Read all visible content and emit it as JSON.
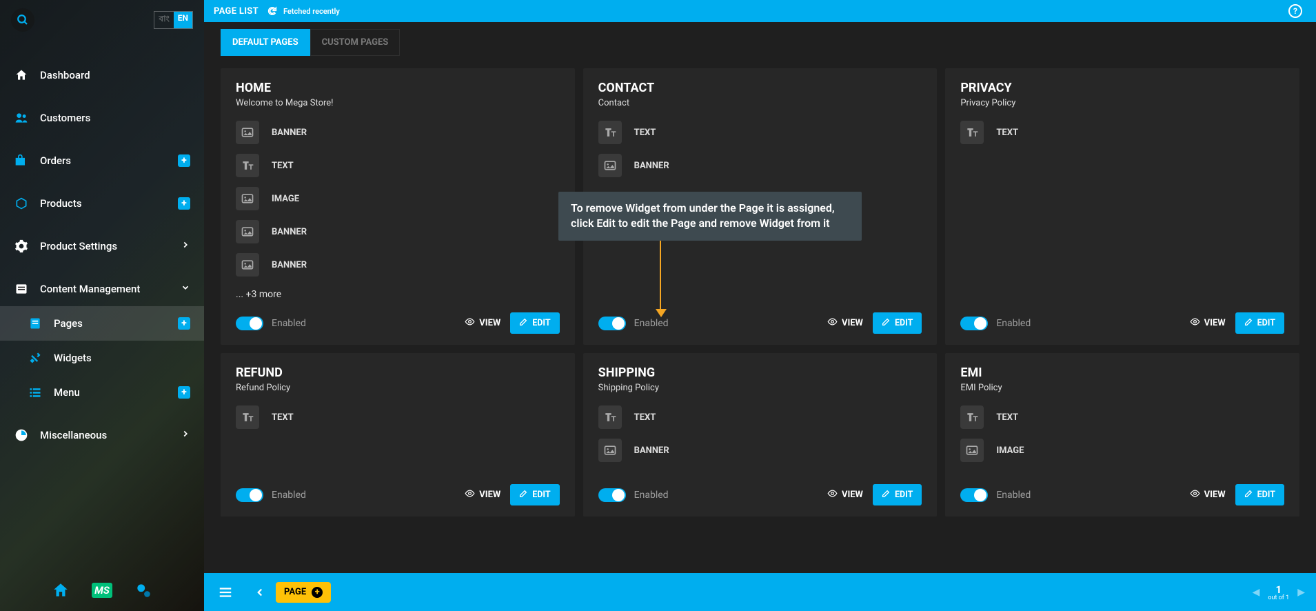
{
  "lang": {
    "inactive": "বাং",
    "active": "EN"
  },
  "sidebar": {
    "items": [
      {
        "label": "Dashboard"
      },
      {
        "label": "Customers"
      },
      {
        "label": "Orders"
      },
      {
        "label": "Products"
      },
      {
        "label": "Product Settings"
      },
      {
        "label": "Content Management"
      },
      {
        "label": "Pages"
      },
      {
        "label": "Widgets"
      },
      {
        "label": "Menu"
      },
      {
        "label": "Miscellaneous"
      }
    ],
    "footer_ms": "MS"
  },
  "topbar": {
    "title": "PAGE LIST",
    "fetched": "Fetched recently",
    "help": "?"
  },
  "tabs": {
    "default": "DEFAULT PAGES",
    "custom": "CUSTOM PAGES"
  },
  "tooltip": "To remove Widget from under the Page it is assigned, click Edit to edit the Page and remove Widget from it",
  "widget_labels": {
    "banner": "BANNER",
    "text": "TEXT",
    "image": "IMAGE"
  },
  "common": {
    "enabled": "Enabled",
    "view": "VIEW",
    "edit": "EDIT",
    "more": "... +3 more"
  },
  "pages": [
    {
      "title": "HOME",
      "sub": "Welcome to Mega Store!",
      "widgets": [
        "banner",
        "text",
        "image",
        "banner",
        "banner"
      ],
      "more": true
    },
    {
      "title": "CONTACT",
      "sub": "Contact",
      "widgets": [
        "text",
        "banner"
      ]
    },
    {
      "title": "PRIVACY",
      "sub": "Privacy Policy",
      "widgets": [
        "text"
      ]
    },
    {
      "title": "REFUND",
      "sub": "Refund Policy",
      "widgets": [
        "text"
      ]
    },
    {
      "title": "SHIPPING",
      "sub": "Shipping Policy",
      "widgets": [
        "text",
        "banner"
      ]
    },
    {
      "title": "EMI",
      "sub": "EMI Policy",
      "widgets": [
        "text",
        "image"
      ]
    }
  ],
  "bottombar": {
    "page": "PAGE",
    "plus": "+",
    "current": "1",
    "outof": "out of 1"
  }
}
